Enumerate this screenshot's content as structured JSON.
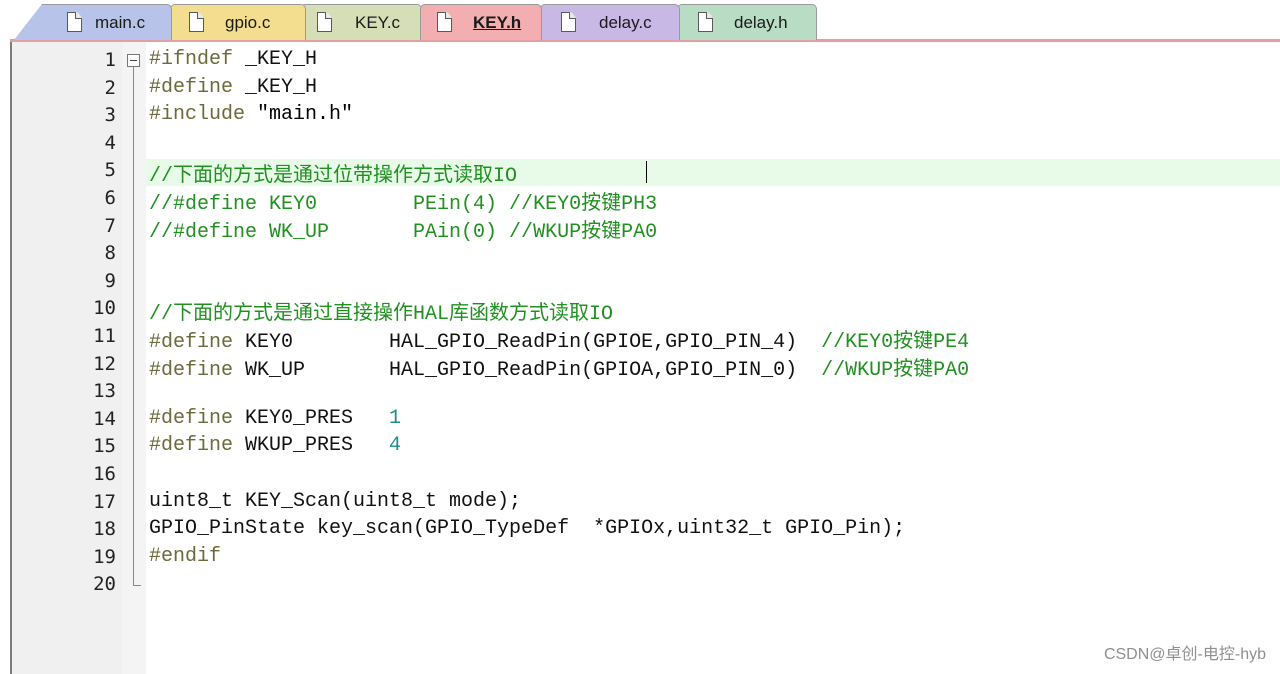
{
  "tabs": [
    {
      "label": "main.c",
      "color": "#b7c3e8",
      "active": false
    },
    {
      "label": "gpio.c",
      "color": "#f3dd8e",
      "active": false
    },
    {
      "label": "KEY.c",
      "color": "#d5deb6",
      "active": false
    },
    {
      "label": "KEY.h",
      "color": "#f2aeb0",
      "active": true
    },
    {
      "label": "delay.c",
      "color": "#c8b8e6",
      "active": false
    },
    {
      "label": "delay.h",
      "color": "#b8dcc4",
      "active": false
    }
  ],
  "editor": {
    "lines": [
      {
        "n": "1",
        "parts": [
          [
            "pre",
            "#ifndef"
          ],
          [
            "plain",
            " _KEY_H"
          ]
        ]
      },
      {
        "n": "2",
        "parts": [
          [
            "pre",
            "#define"
          ],
          [
            "plain",
            " _KEY_H"
          ]
        ]
      },
      {
        "n": "3",
        "parts": [
          [
            "pre",
            "#include"
          ],
          [
            "plain",
            " "
          ],
          [
            "str",
            "\"main.h\""
          ]
        ]
      },
      {
        "n": "4",
        "parts": []
      },
      {
        "n": "5",
        "parts": [
          [
            "com",
            "//下面的方式是通过位带操作方式读取IO"
          ]
        ]
      },
      {
        "n": "6",
        "parts": [
          [
            "com",
            "//#define KEY0        PEin(4) //KEY0按键PH3"
          ]
        ]
      },
      {
        "n": "7",
        "parts": [
          [
            "com",
            "//#define WK_UP       PAin(0) //WKUP按键PA0"
          ]
        ]
      },
      {
        "n": "8",
        "parts": []
      },
      {
        "n": "9",
        "parts": []
      },
      {
        "n": "10",
        "parts": [
          [
            "com",
            "//下面的方式是通过直接操作HAL库函数方式读取IO"
          ]
        ]
      },
      {
        "n": "11",
        "parts": [
          [
            "pre",
            "#define"
          ],
          [
            "plain",
            " KEY0        HAL_GPIO_ReadPin(GPIOE,GPIO_PIN_4)  "
          ],
          [
            "com",
            "//KEY0按键PE4"
          ]
        ]
      },
      {
        "n": "12",
        "parts": [
          [
            "pre",
            "#define"
          ],
          [
            "plain",
            " WK_UP       HAL_GPIO_ReadPin(GPIOA,GPIO_PIN_0)  "
          ],
          [
            "com",
            "//WKUP按键PA0"
          ]
        ]
      },
      {
        "n": "13",
        "parts": []
      },
      {
        "n": "14",
        "parts": [
          [
            "pre",
            "#define"
          ],
          [
            "plain",
            " KEY0_PRES   "
          ],
          [
            "num",
            "1"
          ]
        ]
      },
      {
        "n": "15",
        "parts": [
          [
            "pre",
            "#define"
          ],
          [
            "plain",
            " WKUP_PRES   "
          ],
          [
            "num",
            "4"
          ]
        ]
      },
      {
        "n": "16",
        "parts": []
      },
      {
        "n": "17",
        "parts": [
          [
            "plain",
            "uint8_t KEY_Scan(uint8_t mode);"
          ]
        ]
      },
      {
        "n": "18",
        "parts": [
          [
            "plain",
            "GPIO_PinState key_scan(GPIO_TypeDef  *GPIOx,uint32_t GPIO_Pin);"
          ]
        ]
      },
      {
        "n": "19",
        "parts": [
          [
            "pre",
            "#endif"
          ]
        ]
      },
      {
        "n": "20",
        "parts": []
      }
    ],
    "current_line": "5"
  },
  "watermark": "CSDN@卓创-电控-hyb"
}
